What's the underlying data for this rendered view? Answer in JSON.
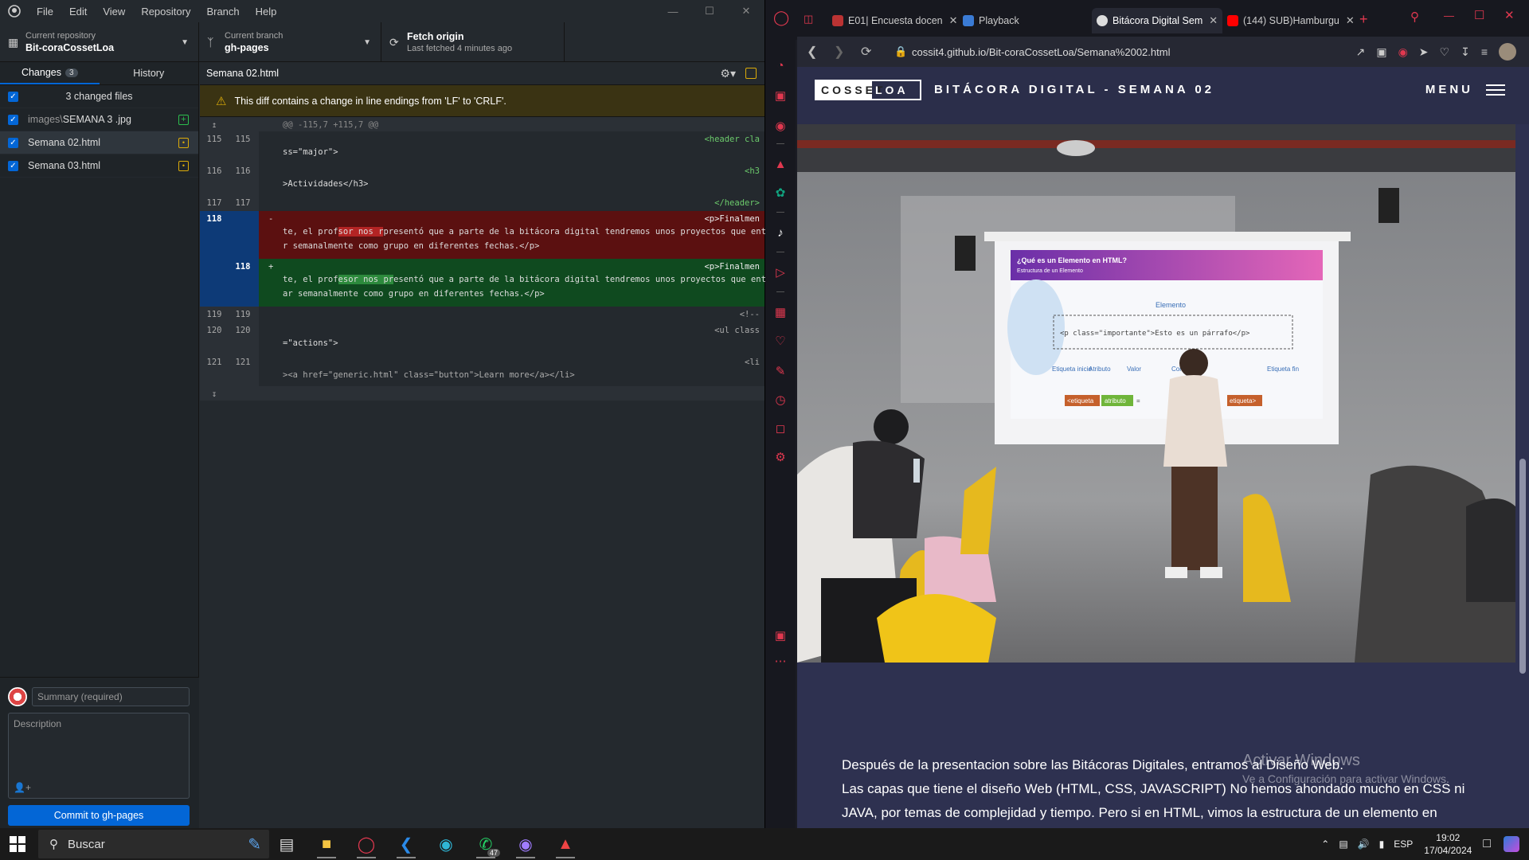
{
  "github_desktop": {
    "menu": [
      "File",
      "Edit",
      "View",
      "Repository",
      "Branch",
      "Help"
    ],
    "toolbar": {
      "repo_label": "Current repository",
      "repo_value": "Bit-coraCossetLoa",
      "branch_label": "Current branch",
      "branch_value": "gh-pages",
      "fetch_label": "Fetch origin",
      "fetch_sub": "Last fetched 4 minutes ago"
    },
    "tabs": {
      "changes": "Changes",
      "changes_count": "3",
      "history": "History"
    },
    "changed_files_summary": "3 changed files",
    "files": [
      {
        "dir": "images\\",
        "name": "SEMANA 3 .jpg",
        "status": "+"
      },
      {
        "dir": "",
        "name": "Semana 02.html",
        "status": "•"
      },
      {
        "dir": "",
        "name": "Semana 03.html",
        "status": "•"
      }
    ],
    "commit": {
      "summary_placeholder": "Summary (required)",
      "description_placeholder": "Description",
      "button": "Commit to gh-pages"
    },
    "diff": {
      "file": "Semana 02.html",
      "warning": "This diff contains a change in line endings from 'LF' to 'CRLF'.",
      "hunk": "@@ -115,7 +115,7 @@",
      "lines": {
        "l115a": "<header cla",
        "l115b": "ss=\"major\">",
        "l116a": "<h3",
        "l116b": ">Actividades</h3>",
        "l117": "</header>",
        "l118_old_a": "<p>Finalmen",
        "l118_old_b1": "te, el prof",
        "l118_old_hl": "sor nos r",
        "l118_old_b2": "presentó que a parte de la bitácora digital tendremos unos proyectos que entrega",
        "l118_old_c": "r semanalmente como grupo en diferentes fechas.</p>",
        "l118_new_a": "<p>Finalmen",
        "l118_new_b1": "te, el prof",
        "l118_new_hl": "esor nos pr",
        "l118_new_b2": "esentó que a parte de la bitácora digital tendremos unos proyectos que entreg",
        "l118_new_c": "ar semanalmente como grupo en diferentes fechas.</p>",
        "l119": "<!--",
        "l120a": "<ul class",
        "l120b": "=\"actions\">",
        "l121a": "<li",
        "l121b": "><a href=\"generic.html\" class=\"button\">Learn more</a></li>"
      },
      "line_numbers": [
        "115",
        "116",
        "117",
        "118",
        "118",
        "119",
        "120",
        "121"
      ]
    }
  },
  "browser": {
    "tabs": [
      {
        "title": "E01| Encuesta docen",
        "active": false
      },
      {
        "title": "Playback",
        "active": false
      },
      {
        "title": "Bitácora Digital Sem",
        "active": true
      },
      {
        "title": "(144) SUB)Hamburgu",
        "active": false
      }
    ],
    "url": "cossit4.github.io/Bit-coraCossetLoa/Semana%2002.html",
    "site": {
      "logo_left": "COSSET",
      "logo_right": "LOA",
      "title": "BITÁCORA DIGITAL - SEMANA 02",
      "menu": "MENU",
      "slide_title": "¿Qué es un Elemento en HTML?",
      "slide_subtitle": "Estructura de un Elemento",
      "slide_element": "Elemento",
      "slide_code": "<p class=\"importante\">Esto es un párrafo</p>",
      "slide_labels": [
        "Etiqueta inicio",
        "Atributo",
        "Valor",
        "Contenido",
        "Etiqueta fin"
      ],
      "slide_chips": [
        "<etiqueta",
        "atributo",
        "=",
        "etiqueta>"
      ],
      "paragraph_1": "Después de la presentacion sobre las Bitácoras Digitales, entramos al Diseño Web.",
      "paragraph_2": "Las capas que tiene el diseño Web (HTML, CSS, JAVASCRIPT) No hemos ahondado mucho en CSS ni",
      "paragraph_3": "JAVA, por temas de complejidad y tiempo. Pero si en HTML, vimos la estructura de un elemento en"
    }
  },
  "windows": {
    "activate_title": "Activar Windows",
    "activate_sub": "Ve a Configuración para activar Windows.",
    "search_placeholder": "Buscar",
    "whatsapp_badge": "47",
    "lang": "ESP",
    "time": "19:02",
    "date": "17/04/2024"
  }
}
